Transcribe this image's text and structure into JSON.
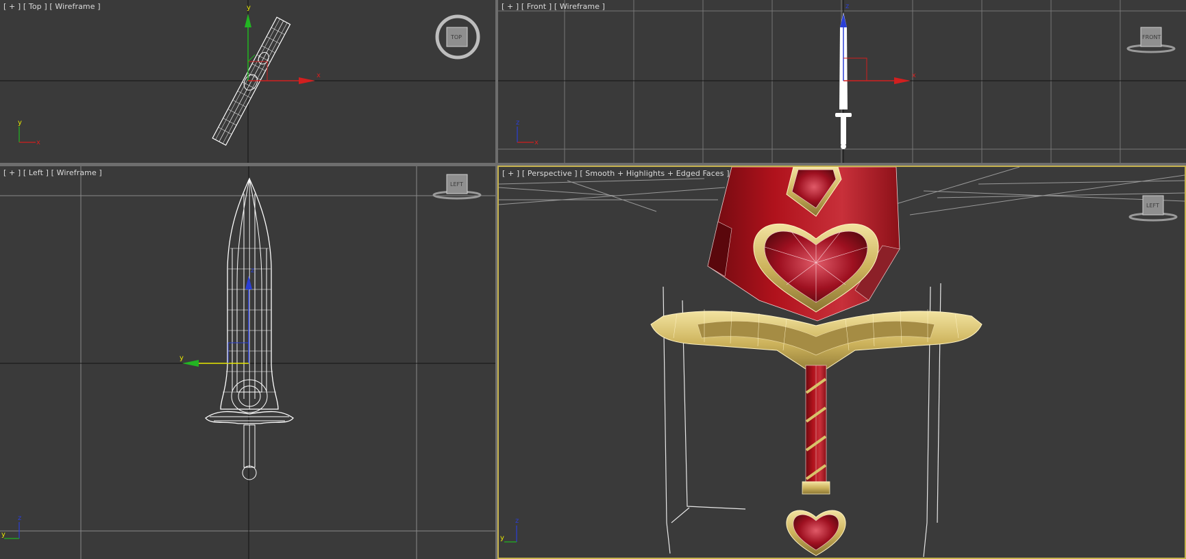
{
  "viewports": {
    "top": {
      "label_plus": "[ + ]",
      "label_view": "[ Top ]",
      "label_mode": "[ Wireframe ]",
      "cube_label": "TOP",
      "gizmo_axes": [
        "y",
        "x"
      ],
      "corner_axes": [
        "y",
        "x"
      ]
    },
    "front": {
      "label_plus": "[ + ]",
      "label_view": "[ Front ]",
      "label_mode": "[ Wireframe ]",
      "cube_label": "FRONT",
      "gizmo_axes": [
        "z",
        "x"
      ],
      "corner_axes": [
        "z",
        "x"
      ]
    },
    "left": {
      "label_plus": "[ + ]",
      "label_view": "[ Left ]",
      "label_mode": "[ Wireframe ]",
      "cube_label": "LEFT",
      "gizmo_axes": [
        "z",
        "y"
      ],
      "corner_axes": [
        "z",
        "y"
      ]
    },
    "perspective": {
      "label_plus": "[ + ]",
      "label_view": "[ Perspective ]",
      "label_mode": "[ Smooth + Highlights + Edged Faces ]",
      "cube_label": "LEFT",
      "corner_axes": [
        "z",
        "y"
      ]
    }
  },
  "colors": {
    "viewport_bg": "#3a3a3a",
    "grid": "#858585",
    "active_border": "#c7b34e",
    "axis_x": "#d21f1f",
    "axis_y": "#22b522",
    "axis_z": "#2a3fd6",
    "wire": "#ffffff",
    "sword_red": "#b0121c",
    "gold": "#d8c36a"
  }
}
